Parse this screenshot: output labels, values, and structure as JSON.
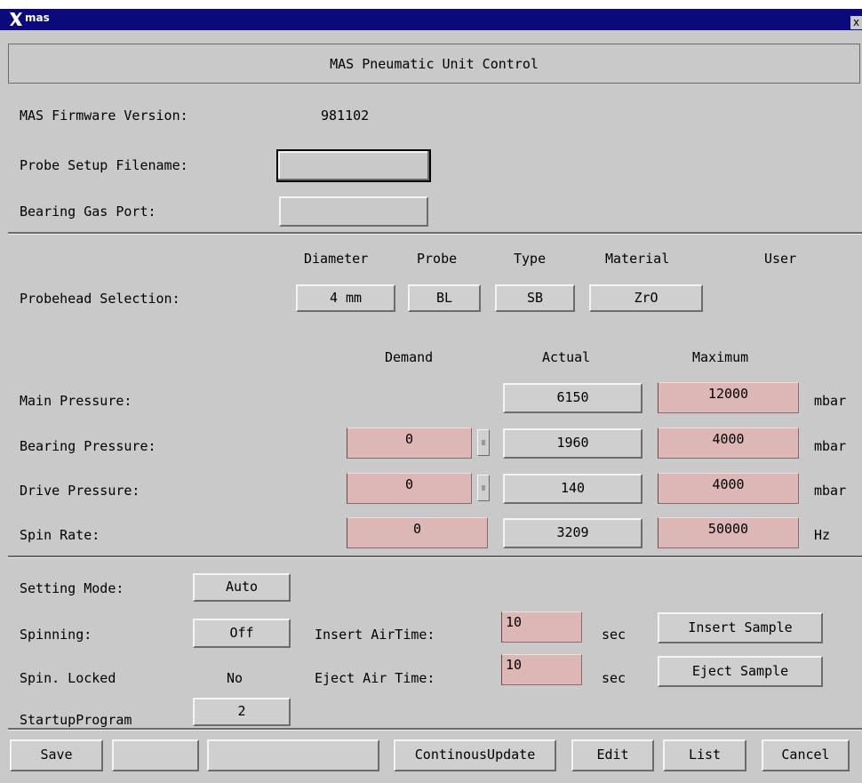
{
  "window": {
    "title": "mas",
    "close_glyph": "x",
    "app_icon": "x-logo-icon"
  },
  "header": {
    "title": "MAS Pneumatic Unit Control"
  },
  "info": {
    "firmware_label": "MAS Firmware Version:",
    "firmware_value": "981102",
    "probe_setup_label": "Probe Setup Filename:",
    "probe_setup_value": "",
    "bearing_port_label": "Bearing Gas Port:",
    "bearing_port_value": ""
  },
  "probehead": {
    "headers": [
      "Diameter",
      "Probe",
      "Type",
      "Material",
      "User"
    ],
    "label": "Probehead Selection:",
    "diameter": "4 mm",
    "probe": "BL",
    "type": "SB",
    "material": "ZrO"
  },
  "pressure": {
    "col_demand": "Demand",
    "col_actual": "Actual",
    "col_maximum": "Maximum",
    "rows": [
      {
        "label": "Main Pressure:",
        "demand": "",
        "actual": "6150",
        "maximum": "12000",
        "unit": "mbar"
      },
      {
        "label": "Bearing Pressure:",
        "demand": "0",
        "actual": "1960",
        "maximum": "4000",
        "unit": "mbar"
      },
      {
        "label": "Drive Pressure:",
        "demand": "0",
        "actual": "140",
        "maximum": "4000",
        "unit": "mbar"
      },
      {
        "label": "Spin Rate:",
        "demand": "0",
        "actual": "3209",
        "maximum": "50000",
        "unit": "Hz"
      }
    ]
  },
  "settings": {
    "setting_mode_label": "Setting Mode:",
    "setting_mode_value": "Auto",
    "spinning_label": "Spinning:",
    "spinning_value": "Off",
    "insert_air_label": "Insert AirTime:",
    "insert_air_value": "10",
    "insert_air_unit": "sec",
    "insert_sample_label": "Insert Sample",
    "spin_locked_label": "Spin. Locked",
    "spin_locked_value": "No",
    "eject_air_label": "Eject Air Time:",
    "eject_air_value": "10",
    "eject_air_unit": "sec",
    "eject_sample_label": "Eject Sample",
    "startup_label": "StartupProgram",
    "startup_value": "2"
  },
  "footer": {
    "save": "Save",
    "blank1": "",
    "blank2": "",
    "continuous": "ContinousUpdate",
    "edit": "Edit",
    "list": "List",
    "cancel": "Cancel"
  },
  "colors": {
    "titlebar": "#0a0a7a",
    "panel": "#c9c9c9",
    "editable": "#ddb6b6"
  }
}
